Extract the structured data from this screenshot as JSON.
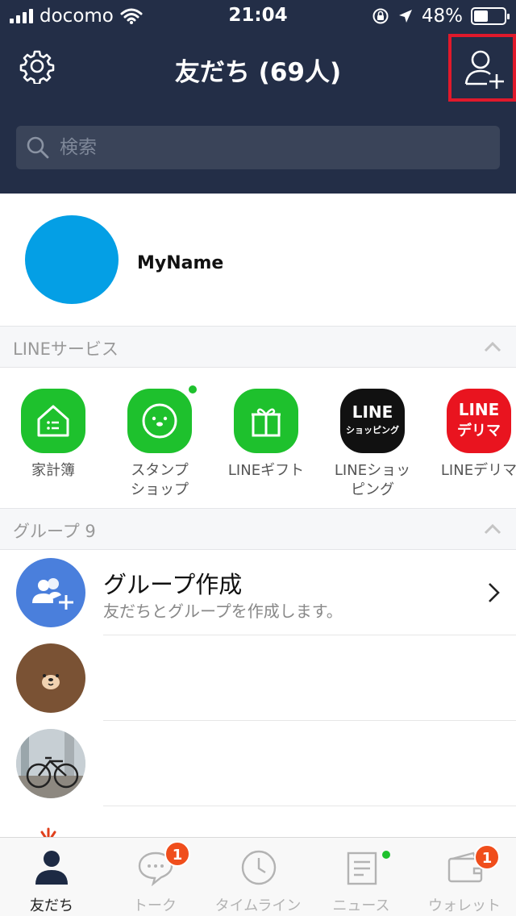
{
  "status_bar": {
    "carrier": "docomo",
    "time": "21:04",
    "battery_text": "48%",
    "battery_level": 0.48
  },
  "header": {
    "title": "友だち (69人)",
    "search_placeholder": "検索"
  },
  "profile": {
    "name": "MyName",
    "avatar_color": "#049fe5"
  },
  "services_section": {
    "title": "LINEサービス"
  },
  "services": [
    {
      "label": "家計簿",
      "icon": "household-ledger-icon",
      "color": "#1ec12d"
    },
    {
      "label": "スタンプ\nショップ",
      "icon": "sticker-shop-icon",
      "color": "#1ec12d"
    },
    {
      "label": "LINEギフト",
      "icon": "gift-icon",
      "color": "#1ec12d"
    },
    {
      "label": "LINEショッ\nピング",
      "icon": "line-shopping-icon",
      "color": "#111111",
      "logo_lines": [
        "LINE",
        "ショッピング"
      ]
    },
    {
      "label": "LINEデリマ",
      "icon": "line-delima-icon",
      "color": "#e9141f",
      "logo_lines": [
        "LINE",
        "デリマ"
      ]
    }
  ],
  "groups_section": {
    "title": "グループ 9"
  },
  "create_group": {
    "title": "グループ作成",
    "subtitle": "友だちとグループを作成します。"
  },
  "tabs": [
    {
      "label": "友だち",
      "icon": "friends-icon",
      "active": true
    },
    {
      "label": "トーク",
      "icon": "chat-icon",
      "badge": "1"
    },
    {
      "label": "タイムライン",
      "icon": "timeline-icon"
    },
    {
      "label": "ニュース",
      "icon": "news-icon",
      "dot": true
    },
    {
      "label": "ウォレット",
      "icon": "wallet-icon",
      "badge": "1"
    }
  ],
  "colors": {
    "header_bg": "#232e47",
    "line_green": "#1ec12d",
    "badge_red": "#f04e1c",
    "highlight_red": "#e0192b"
  }
}
